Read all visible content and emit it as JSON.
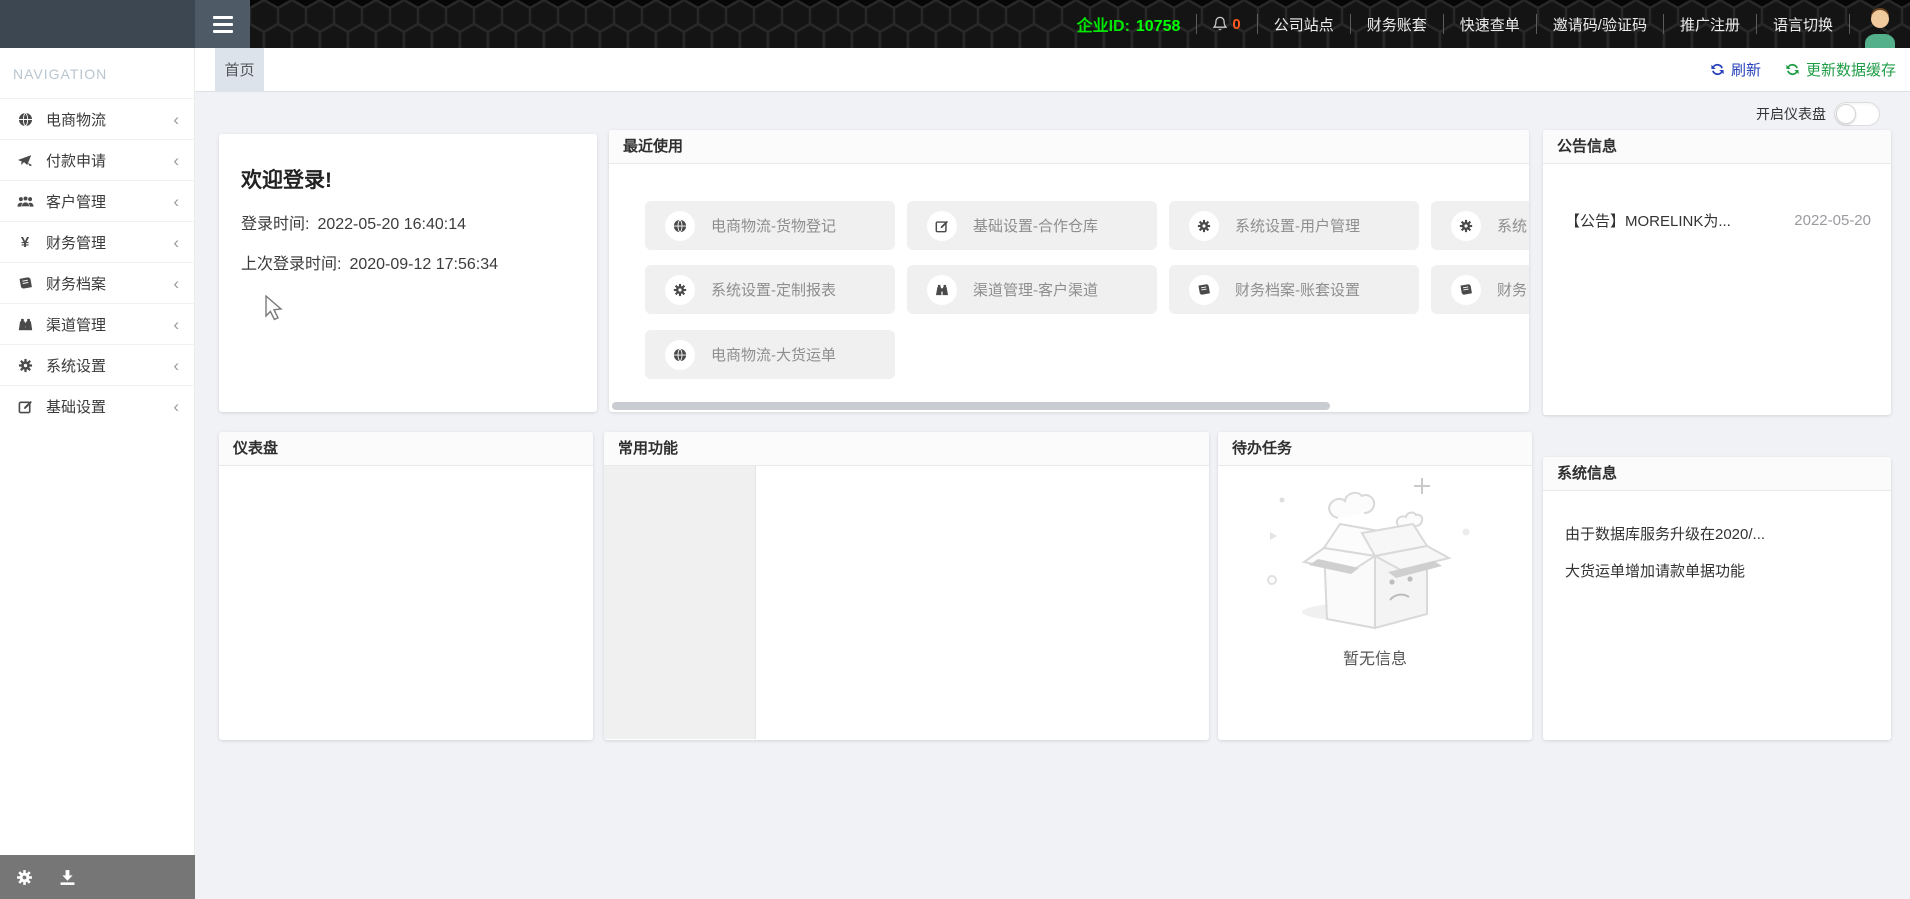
{
  "topbar": {
    "company_id_label": "企业ID:",
    "company_id_value": "10758",
    "notification_count": "0",
    "bell_icon": "bell-icon",
    "avatar_icon": "user-avatar-icon",
    "menu_items": [
      {
        "label": "公司站点"
      },
      {
        "label": "财务账套"
      },
      {
        "label": "快速查单"
      },
      {
        "label": "邀请码/验证码"
      },
      {
        "label": "推广注册"
      },
      {
        "label": "语言切换"
      }
    ]
  },
  "sidebar": {
    "title": "NAVIGATION",
    "chevron": "‹",
    "items": [
      {
        "label": "电商物流",
        "icon": "globe-icon"
      },
      {
        "label": "付款申请",
        "icon": "payment-icon"
      },
      {
        "label": "客户管理",
        "icon": "users-icon"
      },
      {
        "label": "财务管理",
        "icon": "yen-icon",
        "glyph": "¥"
      },
      {
        "label": "财务档案",
        "icon": "book-icon"
      },
      {
        "label": "渠道管理",
        "icon": "binoculars-icon"
      },
      {
        "label": "系统设置",
        "icon": "gear-icon"
      },
      {
        "label": "基础设置",
        "icon": "edit-icon"
      }
    ],
    "footer_icons": [
      "gear-icon",
      "download-icon"
    ]
  },
  "tabbar": {
    "home_tab": "首页",
    "refresh_label": "刷新",
    "update_cache_label": "更新数据缓存"
  },
  "main": {
    "dashboard_toggle_label": "开启仪表盘",
    "welcome": {
      "title": "欢迎登录!",
      "login_time_label": "登录时间:",
      "login_time_value": "2022-05-20 16:40:14",
      "last_login_label": "上次登录时间:",
      "last_login_value": "2020-09-12 17:56:34"
    },
    "recent": {
      "title": "最近使用",
      "items": [
        {
          "label": "电商物流-货物登记",
          "icon": "globe-icon"
        },
        {
          "label": "基础设置-合作仓库",
          "icon": "edit-icon"
        },
        {
          "label": "系统设置-用户管理",
          "icon": "gear-icon"
        },
        {
          "label": "系统",
          "icon": "gear-icon"
        },
        {
          "label": "系统设置-定制报表",
          "icon": "gear-icon"
        },
        {
          "label": "渠道管理-客户渠道",
          "icon": "binoculars-icon"
        },
        {
          "label": "财务档案-账套设置",
          "icon": "book-icon"
        },
        {
          "label": "财务",
          "icon": "book-icon"
        },
        {
          "label": "电商物流-大货运单",
          "icon": "globe-icon"
        }
      ]
    },
    "notice": {
      "title": "公告信息",
      "items": [
        {
          "text": "【公告】MORELINK为...",
          "date": "2022-05-20"
        }
      ]
    },
    "dashboard_panel": {
      "title": "仪表盘"
    },
    "common_panel": {
      "title": "常用功能"
    },
    "todo_panel": {
      "title": "待办任务",
      "empty_text": "暂无信息"
    },
    "system_info": {
      "title": "系统信息",
      "items": [
        {
          "text": "由于数据库服务升级在2020/..."
        },
        {
          "text": "大货运单增加请款单据功能"
        }
      ]
    }
  },
  "colors": {
    "company_id_green": "#00e600",
    "notification_orange": "#ff5a1e",
    "refresh_blue": "#2742bb",
    "cache_green": "#1f9d46",
    "avatar_body_green": "#53b08b",
    "topbar_navy": "#3d4751",
    "footer_gray": "#767676"
  }
}
